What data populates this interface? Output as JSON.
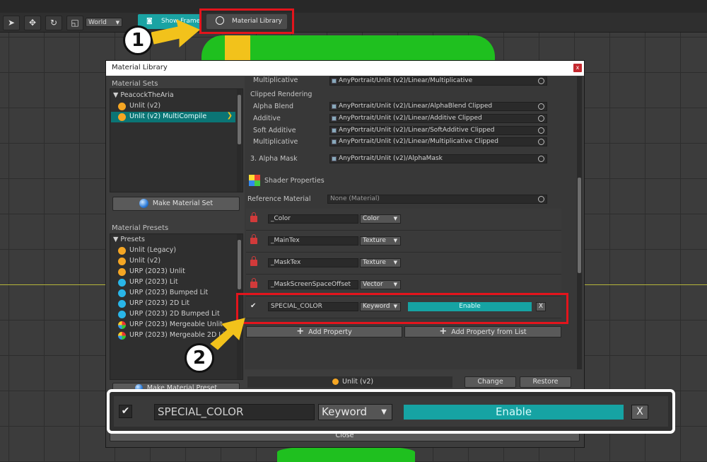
{
  "toolbar": {
    "world_label": "World",
    "show_frame_label": "Show Frame",
    "material_library_label": "Material Library"
  },
  "callouts": {
    "one": "1",
    "two": "2"
  },
  "dialog": {
    "title": "Material Library",
    "close_label": "x",
    "material_sets": {
      "header": "Material Sets",
      "root": "PeacockTheAria",
      "items": [
        {
          "label": "Unlit (v2)",
          "color": "#f5a623",
          "selected": false
        },
        {
          "label": "Unlit (v2) MultiCompile",
          "color": "#f5a623",
          "selected": true
        }
      ],
      "make_button": "Make Material Set"
    },
    "material_presets": {
      "header": "Material Presets",
      "root": "Presets",
      "items": [
        {
          "label": "Unlit (Legacy)",
          "color": "#f5a623"
        },
        {
          "label": "Unlit (v2)",
          "color": "#f5a623"
        },
        {
          "label": "URP (2023) Unlit",
          "color": "#f5a623"
        },
        {
          "label": "URP (2023) Lit",
          "color": "#29b6e8"
        },
        {
          "label": "URP (2023) Bumped Lit",
          "color": "#29b6e8"
        },
        {
          "label": "URP (2023) 2D Lit",
          "color": "#29b6e8"
        },
        {
          "label": "URP (2023) 2D Bumped Lit",
          "color": "#29b6e8"
        },
        {
          "label": "URP (2023) Mergeable Unlit",
          "color": "multi"
        },
        {
          "label": "URP (2023) Mergeable 2D Lit",
          "color": "multi"
        }
      ],
      "make_button": "Make Material Preset"
    },
    "shader_rows": {
      "multiplicative_top": {
        "label": "Multiplicative",
        "value": "AnyPortrait/Unlit (v2)/Linear/Multiplicative"
      },
      "clipped_header": "Clipped Rendering",
      "clipped": [
        {
          "label": "Alpha Blend",
          "value": "AnyPortrait/Unlit (v2)/Linear/AlphaBlend Clipped"
        },
        {
          "label": "Additive",
          "value": "AnyPortrait/Unlit (v2)/Linear/Additive Clipped"
        },
        {
          "label": "Soft Additive",
          "value": "AnyPortrait/Unlit (v2)/Linear/SoftAdditive Clipped"
        },
        {
          "label": "Multiplicative",
          "value": "AnyPortrait/Unlit (v2)/Linear/Multiplicative Clipped"
        }
      ],
      "alpha_mask": {
        "label": "3. Alpha Mask",
        "value": "AnyPortrait/Unlit (v2)/AlphaMask"
      }
    },
    "shader_properties_header": "Shader Properties",
    "reference_material": {
      "label": "Reference Material",
      "value": "None (Material)"
    },
    "properties": [
      {
        "name": "_Color",
        "type": "Color"
      },
      {
        "name": "_MainTex",
        "type": "Texture"
      },
      {
        "name": "_MaskTex",
        "type": "Texture"
      },
      {
        "name": "_MaskScreenSpaceOffset",
        "type": "Vector"
      }
    ],
    "special_property": {
      "name": "SPECIAL_COLOR",
      "type": "Keyword",
      "value": "Enable",
      "remove": "X"
    },
    "add_property": "Add Property",
    "add_property_from_list": "Add Property from List",
    "current_set": "Unlit (v2)",
    "change_button": "Change",
    "restore_button": "Restore",
    "close_button": "Close"
  },
  "zoom": {
    "name": "SPECIAL_COLOR",
    "type": "Keyword",
    "value": "Enable",
    "remove": "X"
  }
}
